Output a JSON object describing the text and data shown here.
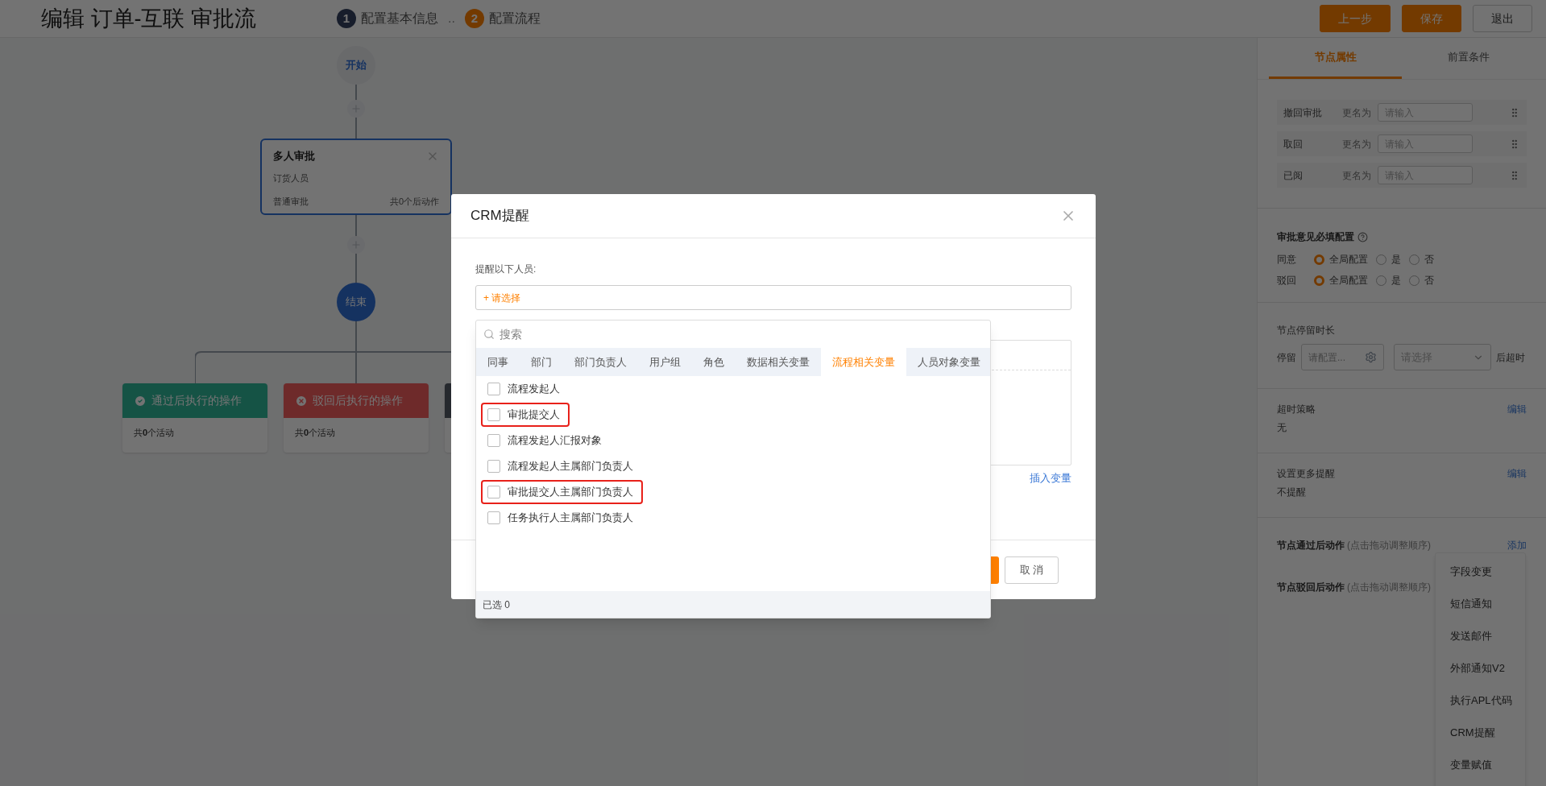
{
  "header": {
    "title": "编辑 订单-互联 审批流",
    "steps": [
      {
        "number": "1",
        "label": "配置基本信息",
        "selected": false
      },
      {
        "number": "2",
        "label": "配置流程",
        "selected": true
      }
    ],
    "separator": "..",
    "buttons": [
      {
        "label": "上一步",
        "kind": "primary"
      },
      {
        "label": "保存",
        "kind": "primary"
      },
      {
        "label": "退出",
        "kind": "outline"
      }
    ]
  },
  "flow": {
    "start": "开始",
    "node": {
      "title": "多人审批",
      "assignee": "订货人员",
      "type": "普通审批",
      "actions": "共0个后动作"
    },
    "end": "结束",
    "branches": [
      {
        "kind": "pass",
        "title": "通过后执行的操作",
        "count_text": "共**0**个活动"
      },
      {
        "kind": "reject",
        "title": "驳回后执行的操作",
        "count_text": "共**0**个活动"
      },
      {
        "kind": "other"
      }
    ]
  },
  "panel": {
    "tabs": [
      {
        "label": "节点属性",
        "selected": true
      },
      {
        "label": "前置条件",
        "selected": false
      }
    ],
    "rename_rows": [
      {
        "action": "撤回审批",
        "label": "更名为",
        "placeholder": "请输入"
      },
      {
        "action": "取回",
        "label": "更名为",
        "placeholder": "请输入"
      },
      {
        "action": "已阅",
        "label": "更名为",
        "placeholder": "请输入"
      }
    ],
    "opinion": {
      "title": "审批意见必填配置",
      "rows": [
        {
          "label": "同意",
          "options": [
            {
              "label": "全局配置",
              "selected": true
            },
            {
              "label": "是",
              "selected": false
            },
            {
              "label": "否",
              "selected": false
            }
          ]
        },
        {
          "label": "驳回",
          "options": [
            {
              "label": "全局配置",
              "selected": true
            },
            {
              "label": "是",
              "selected": false
            },
            {
              "label": "否",
              "selected": false
            }
          ]
        }
      ]
    },
    "stay": {
      "title": "节点停留时长",
      "label": "停留",
      "config_placeholder": "请配置...",
      "select_placeholder": "请选择",
      "suffix": "后超时"
    },
    "timeout": {
      "title": "超时策略",
      "value": "无",
      "link": "编辑"
    },
    "reminders": {
      "title": "设置更多提醒",
      "value": "不提醒",
      "link": "编辑"
    },
    "pass_actions": {
      "title": "节点通过后动作",
      "hint": "(点击拖动调整顺序)",
      "link": "添加"
    },
    "reject_actions": {
      "title": "节点驳回后动作",
      "hint": "(点击拖动调整顺序)"
    },
    "add_menu": [
      "字段变更",
      "短信通知",
      "发送邮件",
      "外部通知V2",
      "执行APL代码",
      "CRM提醒",
      "变量赋值"
    ]
  },
  "dialog": {
    "title": "CRM提醒",
    "recipients_label": "提醒以下人员:",
    "recipients_placeholder": "+ 请选择",
    "insert_variable": "插入变量",
    "cancel": "取 消"
  },
  "picker": {
    "search_placeholder": "搜索",
    "tabs": [
      {
        "label": "同事",
        "selected": false
      },
      {
        "label": "部门",
        "selected": false
      },
      {
        "label": "部门负责人",
        "selected": false
      },
      {
        "label": "用户组",
        "selected": false
      },
      {
        "label": "角色",
        "selected": false
      },
      {
        "label": "数据相关变量",
        "selected": false
      },
      {
        "label": "流程相关变量",
        "selected": true
      },
      {
        "label": "人员对象变量",
        "selected": false
      }
    ],
    "options": [
      {
        "label": "流程发起人",
        "checked": false,
        "highlighted": false
      },
      {
        "label": "审批提交人",
        "checked": false,
        "highlighted": true
      },
      {
        "label": "流程发起人汇报对象",
        "checked": false,
        "highlighted": false
      },
      {
        "label": "流程发起人主属部门负责人",
        "checked": false,
        "highlighted": false
      },
      {
        "label": "审批提交人主属部门负责人",
        "checked": false,
        "highlighted": true
      },
      {
        "label": "任务执行人主属部门负责人",
        "checked": false,
        "highlighted": false
      }
    ],
    "footer": "已选 0"
  }
}
